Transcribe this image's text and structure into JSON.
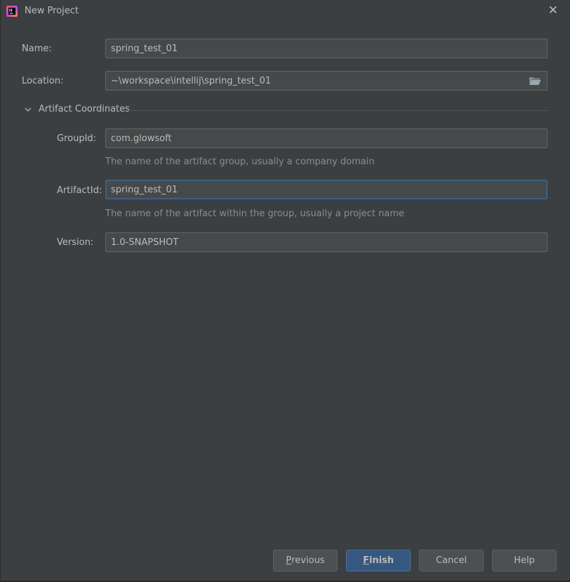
{
  "window": {
    "title": "New Project",
    "close_glyph": "✕"
  },
  "form": {
    "name_label": "Name:",
    "name_value": "spring_test_01",
    "location_label": "Location:",
    "location_value": "~\\workspace\\intellij\\spring_test_01"
  },
  "artifact": {
    "section_label": "Artifact Coordinates",
    "expanded": true,
    "groupid_label": "GroupId:",
    "groupid_value": "com.glowsoft",
    "groupid_hint": "The name of the artifact group, usually a company domain",
    "artifactid_label": "ArtifactId:",
    "artifactid_value": "spring_test_01",
    "artifactid_hint": "The name of the artifact within the group, usually a project name",
    "version_label": "Version:",
    "version_value": "1.0-SNAPSHOT"
  },
  "buttons": {
    "previous_mnemonic": "P",
    "previous_rest": "revious",
    "finish_mnemonic": "F",
    "finish_rest": "inish",
    "cancel": "Cancel",
    "help": "Help"
  },
  "colors": {
    "background": "#3c3f41",
    "field_bg": "#45494a",
    "focus_border": "#3d6185",
    "primary_button": "#365880"
  },
  "icons": {
    "app": "intellij-app-icon",
    "close": "close-icon",
    "folder": "folder-open-icon",
    "chevron": "chevron-down-icon"
  }
}
